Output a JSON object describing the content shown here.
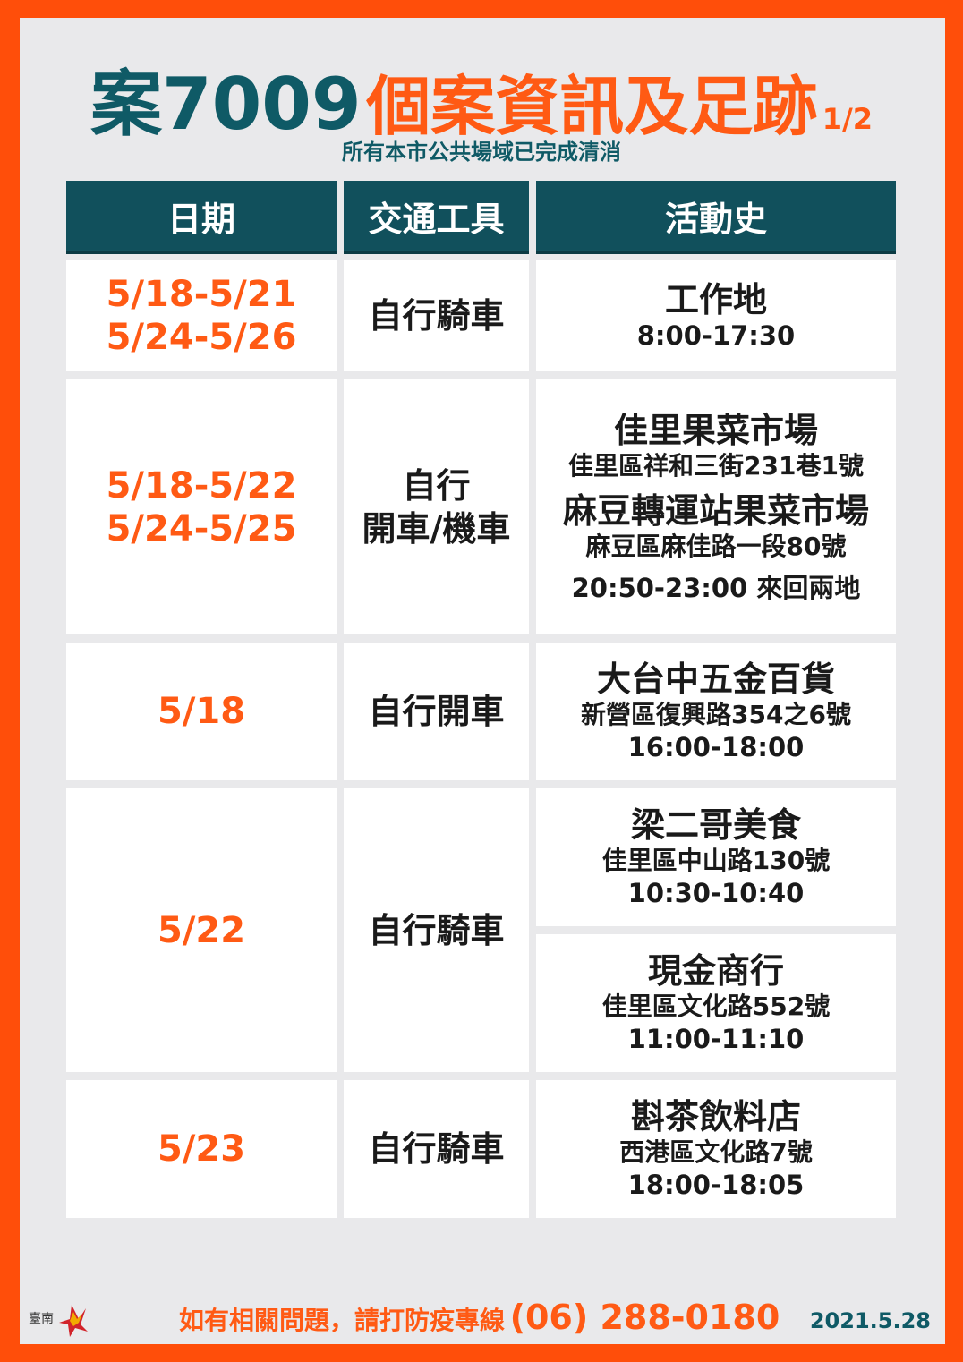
{
  "title": {
    "case": "案7009",
    "main": "個案資訊及足跡",
    "page": "1/2"
  },
  "subtitle": "所有本市公共場域已完成清消",
  "headers": [
    "日期",
    "交通工具",
    "活動史"
  ],
  "rows": [
    {
      "dates": [
        "5/18-5/21",
        "5/24-5/26"
      ],
      "transport": [
        "自行騎車"
      ],
      "places": [
        {
          "name": "工作地",
          "address": "",
          "time": "8:00-17:30"
        }
      ]
    },
    {
      "dates": [
        "5/18-5/22",
        "5/24-5/25"
      ],
      "transport": [
        "自行",
        "開車/機車"
      ],
      "places": [
        {
          "name": "佳里果菜市場",
          "address": "佳里區祥和三街231巷1號",
          "time": ""
        },
        {
          "name": "麻豆轉運站果菜市場",
          "address": "麻豆區麻佳路一段80號",
          "time": "20:50-23:00 來回兩地"
        }
      ]
    },
    {
      "dates": [
        "5/18"
      ],
      "transport": [
        "自行開車"
      ],
      "places": [
        {
          "name": "大台中五金百貨",
          "address": "新營區復興路354之6號",
          "time": "16:00-18:00"
        }
      ]
    },
    {
      "dates": [
        "5/22"
      ],
      "transport": [
        "自行騎車"
      ],
      "places": [
        {
          "name": "梁二哥美食",
          "address": "佳里區中山路130號",
          "time": "10:30-10:40"
        },
        {
          "name": "現金商行",
          "address": "佳里區文化路552號",
          "time": "11:00-11:10"
        }
      ]
    },
    {
      "dates": [
        "5/23"
      ],
      "transport": [
        "自行騎車"
      ],
      "places": [
        {
          "name": "斟茶飲料店",
          "address": "西港區文化路7號",
          "time": "18:00-18:05"
        }
      ]
    }
  ],
  "footer": {
    "message": "如有相關問題，請打防疫專線",
    "phone": "(06) 288-0180",
    "date": "2021.5.28"
  },
  "logo": {
    "icon": "tainan-city-logo-icon",
    "text": "臺南"
  },
  "colors": {
    "border": "#ff4e0a",
    "background": "#e9e9eb",
    "header": "#11505c",
    "accent": "#ff5a14",
    "teal_text": "#0f5a66"
  }
}
